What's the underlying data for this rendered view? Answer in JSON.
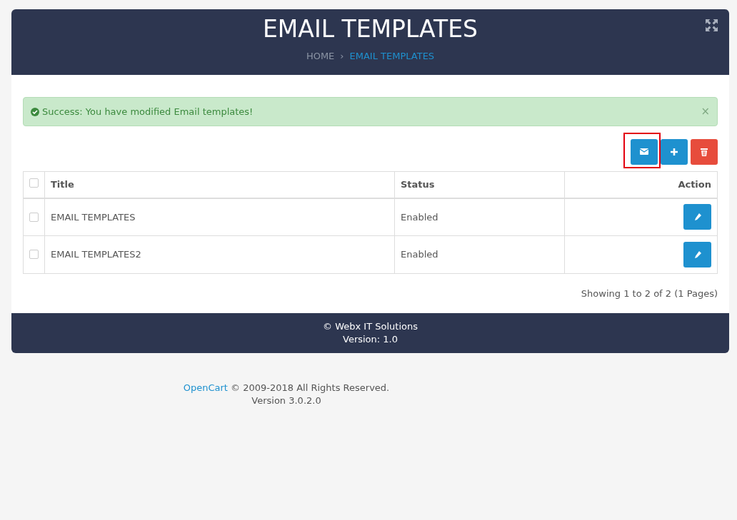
{
  "header": {
    "title": "EMAIL TEMPLATES",
    "breadcrumb_separator": "›",
    "breadcrumb": [
      {
        "label": "HOME",
        "current": false
      },
      {
        "label": "EMAIL TEMPLATES",
        "current": true
      }
    ]
  },
  "alert": {
    "message": "Success: You have modified Email templates!",
    "close": "×"
  },
  "toolbar": [
    {
      "kind": "mail",
      "highlighted": true
    },
    {
      "kind": "add",
      "highlighted": false
    },
    {
      "kind": "delete",
      "highlighted": false
    }
  ],
  "table": {
    "select_all": {
      "checked": false
    },
    "columns": [
      "Title",
      "Status",
      "Action"
    ],
    "rows": [
      {
        "checked": false,
        "title": "EMAIL TEMPLATES",
        "status": "Enabled"
      },
      {
        "checked": false,
        "title": "EMAIL TEMPLATES2",
        "status": "Enabled"
      }
    ]
  },
  "pagination": "Showing 1 to 2 of 2 (1 Pages)",
  "card_footer": [
    "© Webx IT Solutions",
    "Version: 1.0"
  ],
  "page_footer": {
    "link": "OpenCart",
    "text": " © 2009-2018 All Rights Reserved.",
    "version": "Version 3.0.2.0"
  }
}
